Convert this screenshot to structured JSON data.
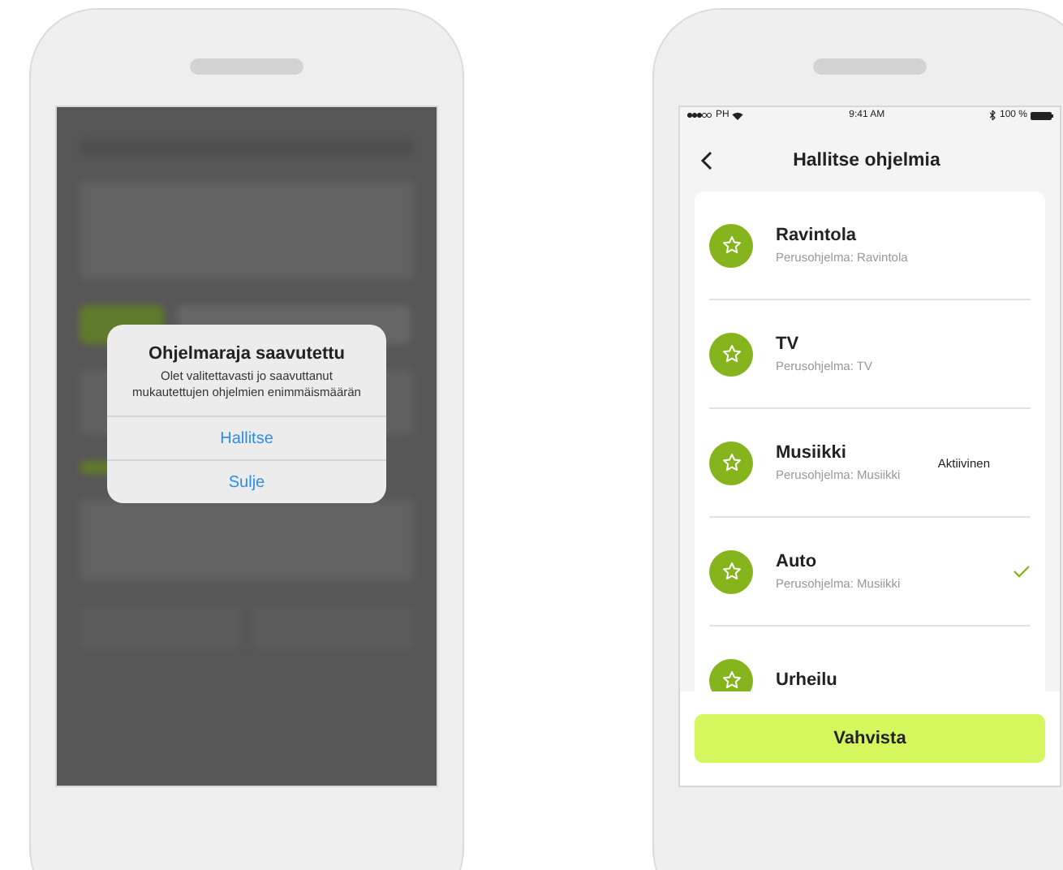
{
  "phones": [
    {
      "kind": "dialog",
      "dialog": {
        "title": "Ohjelmaraja saavutettu",
        "message": "Olet valitettavasti jo saavuttanut mukautettujen ohjelmien enimmäismäärän",
        "actions": [
          "Hallitse",
          "Sulje"
        ]
      }
    },
    {
      "kind": "list",
      "status_bar": {
        "carrier": "PH",
        "time": "9:41 AM",
        "battery": "100 %"
      },
      "header": {
        "title": "Hallitse ohjelmia"
      },
      "programs": [
        {
          "name": "Ravintola",
          "base": "Perusohjelma: Ravintola",
          "selected": false
        },
        {
          "name": "TV",
          "base": "Perusohjelma: TV",
          "selected": false
        },
        {
          "name": "Musiikki",
          "base": "Perusohjelma: Musiikki",
          "status": "Aktiivinen",
          "selected": false
        },
        {
          "name": "Auto",
          "base": "Perusohjelma: Musiikki",
          "selected": true
        },
        {
          "name": "Urheilu",
          "selected": false
        }
      ],
      "confirm_button": "Vahvista"
    }
  ]
}
